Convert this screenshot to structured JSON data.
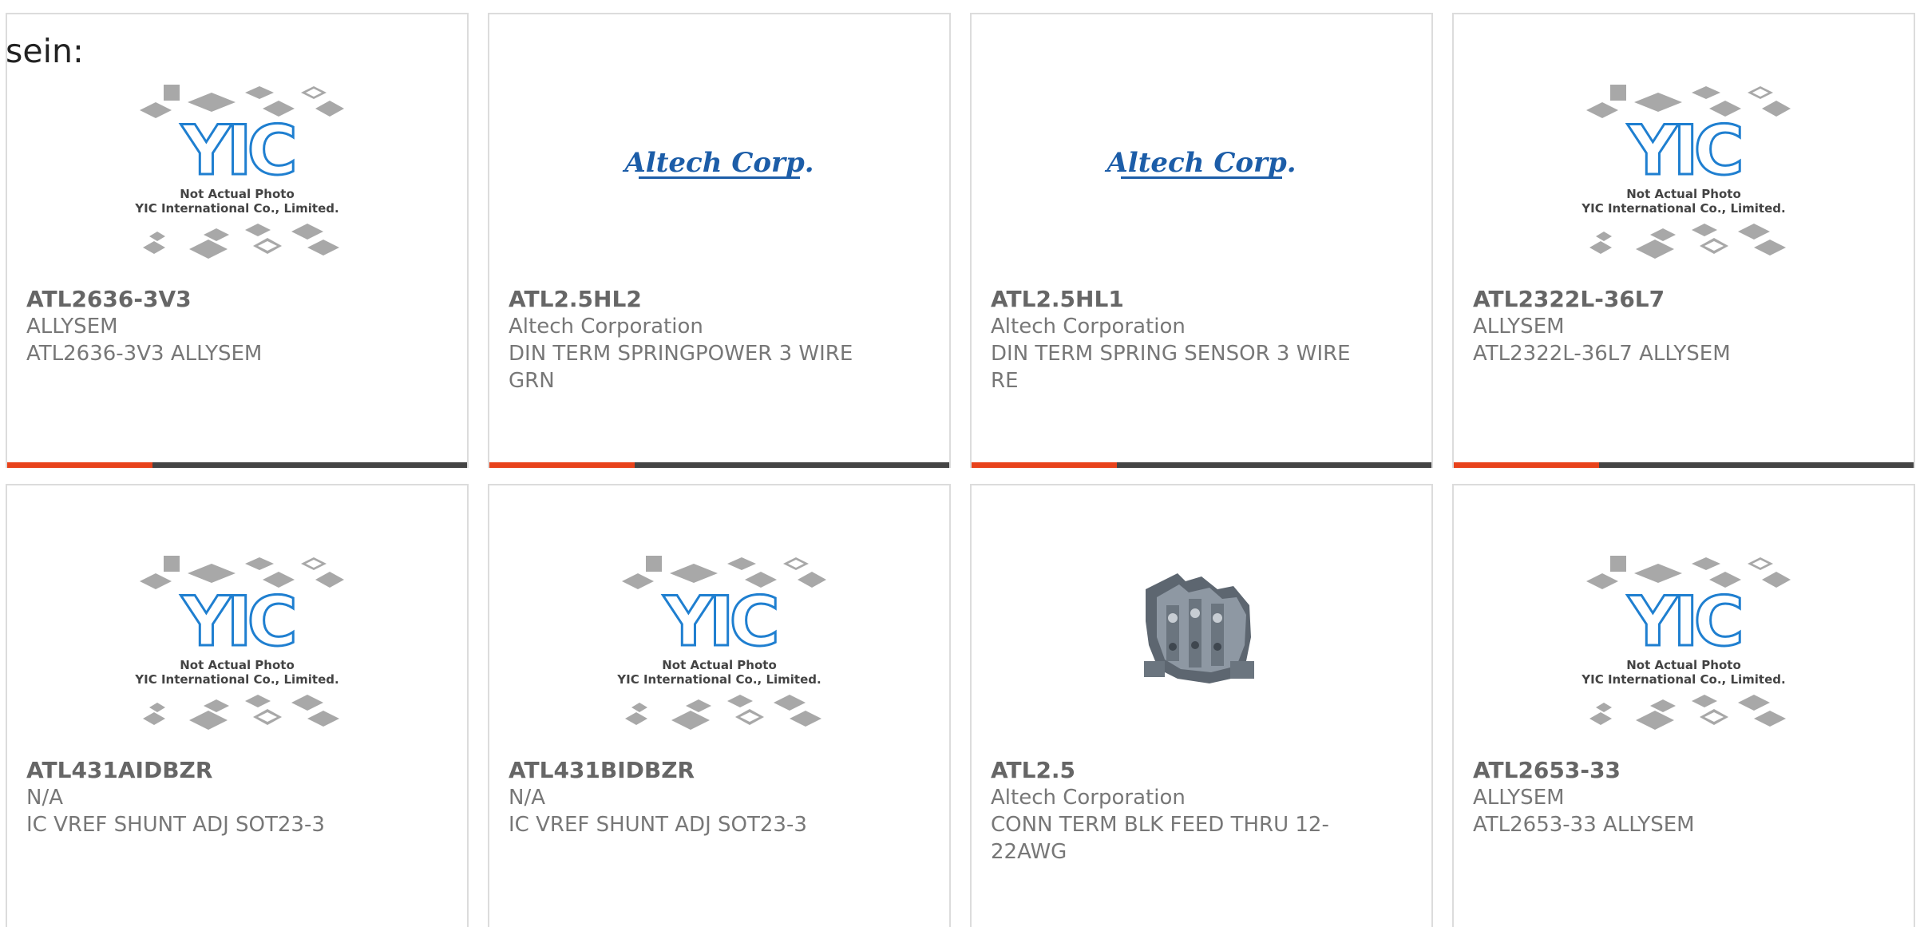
{
  "header_fragment": "sein:",
  "brand_colors": {
    "accent": "#e8421b",
    "bar": "#444444",
    "altech_blue": "#1c5da8",
    "yic_blue": "#1f7fd0"
  },
  "placeholder_image": {
    "caption_line1": "Not Actual Photo",
    "caption_line2": "YIC International Co., Limited.",
    "logo_text": "YIC"
  },
  "altech_logo_text": "Altech Corp.",
  "products": [
    {
      "part_number": "ATL2636-3V3",
      "manufacturer": "ALLYSEM",
      "description": "ATL2636-3V3 ALLYSEM",
      "image": "yic-placeholder"
    },
    {
      "part_number": "ATL2.5HL2",
      "manufacturer": "Altech Corporation",
      "description": "DIN TERM SPRINGPOWER 3 WIRE GRN",
      "image": "altech-logo"
    },
    {
      "part_number": "ATL2.5HL1",
      "manufacturer": "Altech Corporation",
      "description": "DIN TERM SPRING SENSOR 3 WIRE RE",
      "image": "altech-logo"
    },
    {
      "part_number": "ATL2322L-36L7",
      "manufacturer": "ALLYSEM",
      "description": "ATL2322L-36L7 ALLYSEM",
      "image": "yic-placeholder"
    },
    {
      "part_number": "ATL431AIDBZR",
      "manufacturer": "N/A",
      "description": "IC VREF SHUNT ADJ SOT23-3",
      "image": "yic-placeholder"
    },
    {
      "part_number": "ATL431BIDBZR",
      "manufacturer": "N/A",
      "description": "IC VREF SHUNT ADJ SOT23-3",
      "image": "yic-placeholder"
    },
    {
      "part_number": "ATL2.5",
      "manufacturer": "Altech Corporation",
      "description": "CONN TERM BLK FEED THRU 12-22AWG",
      "image": "terminal-block-photo"
    },
    {
      "part_number": "ATL2653-33",
      "manufacturer": "ALLYSEM",
      "description": "ATL2653-33 ALLYSEM",
      "image": "yic-placeholder"
    }
  ]
}
